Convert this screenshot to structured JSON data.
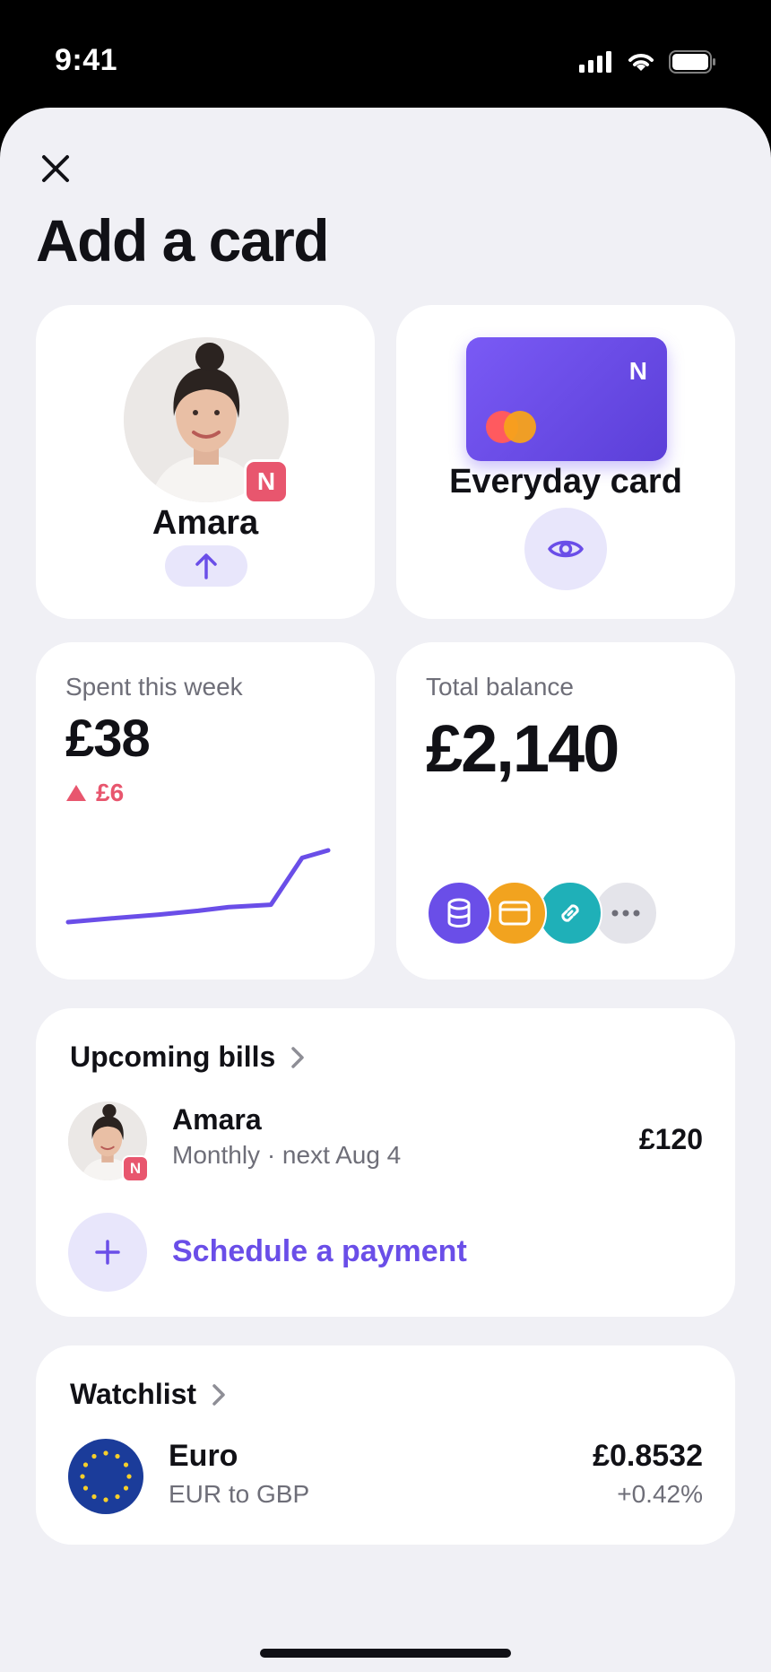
{
  "status_bar": {
    "time": "9:41"
  },
  "header": {
    "title": "Add a card"
  },
  "profile": {
    "name": "Amara",
    "badge": "N"
  },
  "everyday_card": {
    "title": "Everyday card",
    "card_mark": "N"
  },
  "spent": {
    "label": "Spent this week",
    "amount": "£38",
    "delta": "£6",
    "trend_values": [
      0,
      0.5,
      1,
      1.5,
      2,
      2.3,
      8.5,
      9.5
    ]
  },
  "balance": {
    "label": "Total balance",
    "amount": "£2,140",
    "accounts": [
      {
        "icon": "database-icon",
        "color": "#6a4ee8"
      },
      {
        "icon": "card-icon",
        "color": "#f2a31f"
      },
      {
        "icon": "link-icon",
        "color": "#1fb0b8"
      },
      {
        "icon": "more-icon",
        "color": "#e4e4ea"
      }
    ]
  },
  "bills": {
    "title": "Upcoming bills",
    "items": [
      {
        "name": "Amara",
        "badge": "N",
        "schedule": "Monthly · next Aug 4",
        "amount": "£120"
      }
    ],
    "schedule_label": "Schedule a payment"
  },
  "watchlist": {
    "title": "Watchlist",
    "items": [
      {
        "name": "Euro",
        "pair": "EUR to GBP",
        "rate": "£0.8532",
        "change": "+0.42%"
      }
    ]
  },
  "colors": {
    "accent": "#6a4ee8",
    "accent_soft": "#e8e6fb",
    "badge": "#e8566e",
    "background": "#f0f0f5"
  }
}
